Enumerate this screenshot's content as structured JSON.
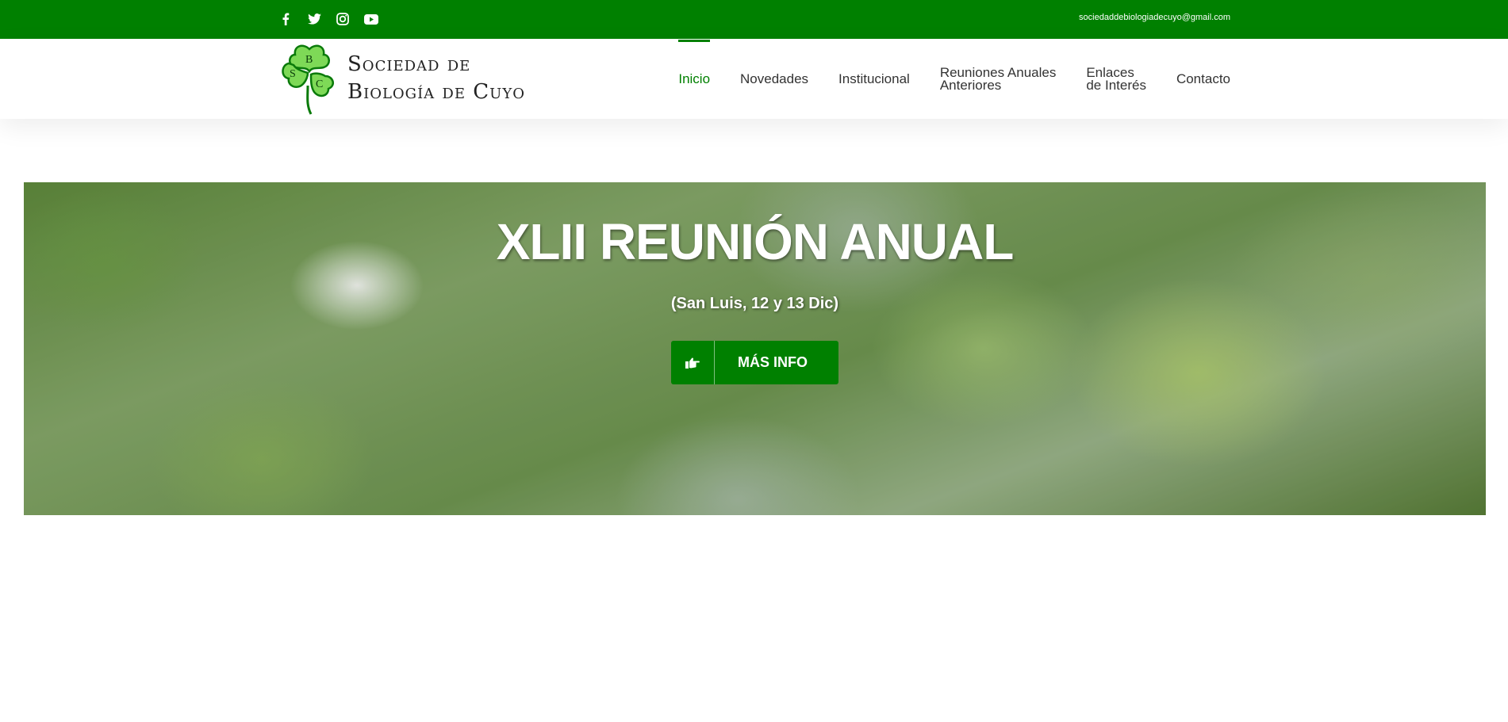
{
  "topbar": {
    "email": "sociedaddebiologiadecuyo@gmail.com",
    "social": [
      "facebook-icon",
      "twitter-icon",
      "instagram-icon",
      "youtube-icon"
    ],
    "background": "#008000"
  },
  "logo": {
    "line1": "Sociedad de",
    "line2": "Biología de Cuyo",
    "letters": [
      "S",
      "B",
      "C"
    ]
  },
  "nav": {
    "items": [
      {
        "line1": "Inicio",
        "line2": ""
      },
      {
        "line1": "Novedades",
        "line2": ""
      },
      {
        "line1": "Institucional",
        "line2": ""
      },
      {
        "line1": "Reuniones Anuales",
        "line2": "Anteriores"
      },
      {
        "line1": "Enlaces",
        "line2": "de Interés"
      },
      {
        "line1": "Contacto",
        "line2": ""
      }
    ],
    "active_color": "#008000"
  },
  "hero": {
    "title": "XLII REUNIÓN ANUAL",
    "subtitle": "(San Luis, 12 y 13 Dic)",
    "button_label": "MÁS INFO",
    "button_icon": "hand-pointing-right-icon"
  }
}
